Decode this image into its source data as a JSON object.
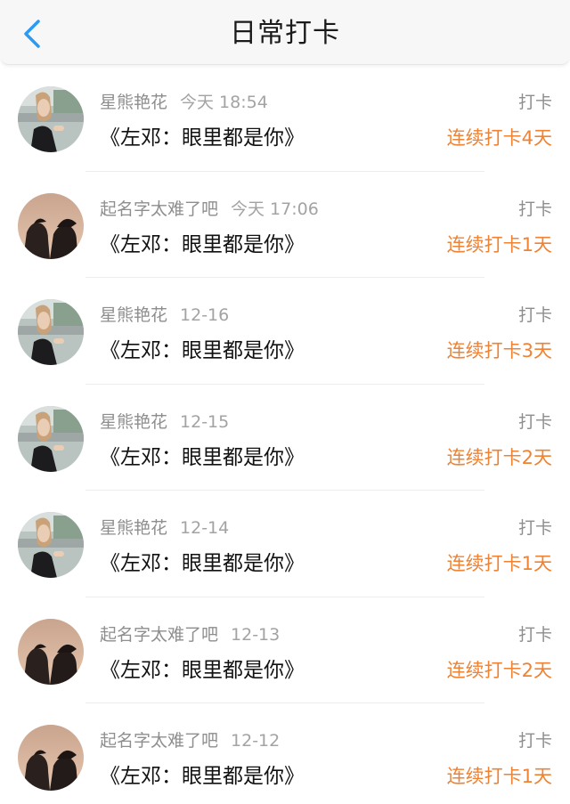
{
  "header": {
    "title": "日常打卡",
    "back_icon": "chevron-left-icon",
    "accent": "#2b9af3"
  },
  "colors": {
    "streak": "#ef8233"
  },
  "items": [
    {
      "user": "星熊艳花",
      "time": "今天 18:54",
      "book": "《左邓：眼里都是你》",
      "tag": "打卡",
      "streak": "连续打卡4天",
      "avatar": "woman-avatar"
    },
    {
      "user": "起名字太难了吧",
      "time": "今天 17:06",
      "book": "《左邓：眼里都是你》",
      "tag": "打卡",
      "streak": "连续打卡1天",
      "avatar": "couple-avatar"
    },
    {
      "user": "星熊艳花",
      "time": "12-16",
      "book": "《左邓：眼里都是你》",
      "tag": "打卡",
      "streak": "连续打卡3天",
      "avatar": "woman-avatar"
    },
    {
      "user": "星熊艳花",
      "time": "12-15",
      "book": "《左邓：眼里都是你》",
      "tag": "打卡",
      "streak": "连续打卡2天",
      "avatar": "woman-avatar"
    },
    {
      "user": "星熊艳花",
      "time": "12-14",
      "book": "《左邓：眼里都是你》",
      "tag": "打卡",
      "streak": "连续打卡1天",
      "avatar": "woman-avatar"
    },
    {
      "user": "起名字太难了吧",
      "time": "12-13",
      "book": "《左邓：眼里都是你》",
      "tag": "打卡",
      "streak": "连续打卡2天",
      "avatar": "couple-avatar"
    },
    {
      "user": "起名字太难了吧",
      "time": "12-12",
      "book": "《左邓：眼里都是你》",
      "tag": "打卡",
      "streak": "连续打卡1天",
      "avatar": "couple-avatar"
    }
  ]
}
